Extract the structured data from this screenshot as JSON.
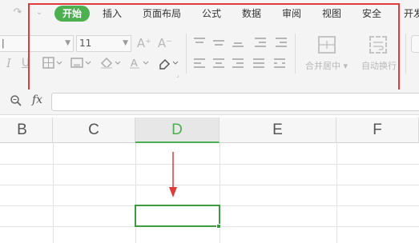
{
  "quick_access": {
    "redo_icon": "redo-icon",
    "dropdown_icon": "chevron-down-icon"
  },
  "tabs": [
    {
      "label": "开始",
      "active": true
    },
    {
      "label": "插入"
    },
    {
      "label": "页面布局"
    },
    {
      "label": "公式"
    },
    {
      "label": "数据"
    },
    {
      "label": "审阅"
    },
    {
      "label": "视图"
    },
    {
      "label": "安全"
    },
    {
      "label": "开发"
    }
  ],
  "font": {
    "size_value": "11"
  },
  "font_buttons": {
    "grow": "A⁺",
    "shrink": "A⁻",
    "italic": "I",
    "underline": "U"
  },
  "alignment": {
    "merge_label": "合并居中",
    "wrap_label": "自动换行"
  },
  "formula_bar": {
    "fx_label": "fx",
    "value": ""
  },
  "columns": [
    "B",
    "C",
    "D",
    "E",
    "F"
  ],
  "selected_column": "D",
  "colors": {
    "accent_green": "#4caf50",
    "annotation_red": "#e03b3b"
  }
}
